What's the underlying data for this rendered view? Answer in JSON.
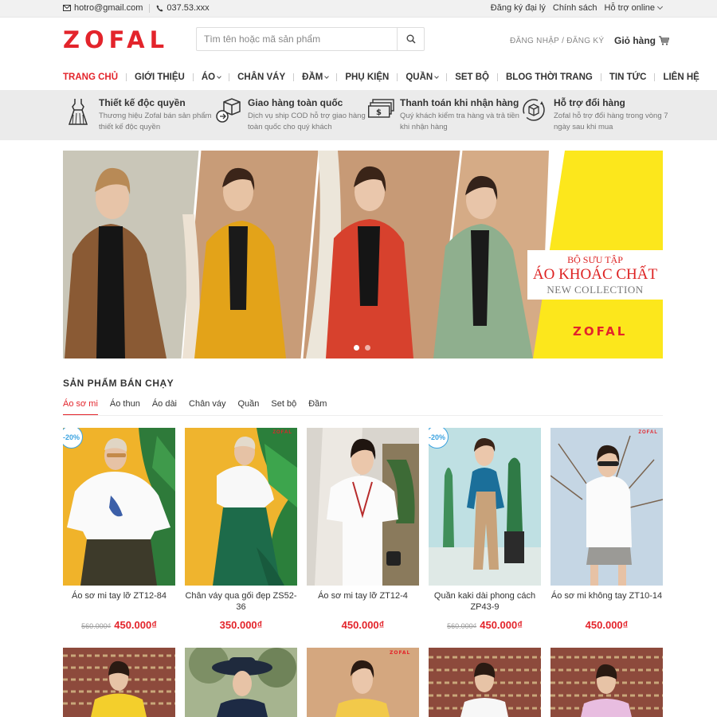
{
  "topbar": {
    "email": "hotro@gmail.com",
    "phone": "037.53.xxx",
    "agency": "Đăng ký đại lý",
    "policy": "Chính sách",
    "support": "Hỗ trợ online"
  },
  "header": {
    "logo": "ZOFAL",
    "search_placeholder": "Tìm tên hoặc mã sản phẩm",
    "login": "ĐĂNG NHẬP",
    "register": "ĐĂNG KÝ",
    "login_sep": "/",
    "cart": "Giỏ hàng"
  },
  "nav": [
    {
      "label": "TRANG CHỦ",
      "active": true
    },
    {
      "label": "GIỚI THIỆU"
    },
    {
      "label": "ÁO",
      "dropdown": true
    },
    {
      "label": "CHÂN VÁY"
    },
    {
      "label": "ĐẦM",
      "dropdown": true
    },
    {
      "label": "PHỤ KIỆN"
    },
    {
      "label": "QUẦN",
      "dropdown": true
    },
    {
      "label": "SET BỘ"
    },
    {
      "label": "BLOG THỜI TRANG"
    },
    {
      "label": "TIN TỨC"
    },
    {
      "label": "LIÊN HỆ"
    }
  ],
  "features": [
    {
      "title": "Thiết kế độc quyền",
      "desc": "Thương hiệu Zofal bán sản phẩm thiết kế độc quyền",
      "icon": "dress-icon"
    },
    {
      "title": "Giao hàng toàn quốc",
      "desc": "Dịch vụ ship COD hỗ trợ giao hàng toàn quốc cho quý khách",
      "icon": "delivery-box-icon"
    },
    {
      "title": "Thanh toán khi nhận hàng",
      "desc": "Quý khách kiểm tra hàng và trả tiền khi nhận hàng",
      "icon": "cash-icon"
    },
    {
      "title": "Hỗ trợ đổi hàng",
      "desc": "Zofal hỗ trợ đổi hàng trong vòng 7 ngày sau khi mua",
      "icon": "exchange-box-icon"
    }
  ],
  "banner": {
    "line1": "BỘ SƯU TẬP",
    "line2": "ÁO KHOÁC CHẤT",
    "line3": "NEW COLLECTION",
    "brand": "ZOFAL"
  },
  "section": {
    "title": "SẢN PHẨM BÁN CHẠY",
    "tabs": [
      {
        "label": "Áo sơ mi",
        "active": true
      },
      {
        "label": "Áo thun"
      },
      {
        "label": "Áo dài"
      },
      {
        "label": "Chân váy"
      },
      {
        "label": "Quần"
      },
      {
        "label": "Set bộ"
      },
      {
        "label": "Đầm"
      }
    ]
  },
  "products": [
    {
      "name": "Áo sơ mi tay lỡ ZT12-84",
      "old_price": "560.000₫",
      "price": "450.000₫",
      "badge": "-20%"
    },
    {
      "name": "Chân váy qua gối đẹp ZS52-36",
      "old_price": "",
      "price": "350.000₫",
      "badge": "",
      "brand": "ZOFAL"
    },
    {
      "name": "Áo sơ mi tay lỡ ZT12-4",
      "old_price": "",
      "price": "450.000₫",
      "badge": ""
    },
    {
      "name": "Quần kaki dài phong cách ZP43-9",
      "old_price": "560.000₫",
      "price": "450.000₫",
      "badge": "-20%"
    },
    {
      "name": "Áo sơ mi không tay ZT10-14",
      "old_price": "",
      "price": "450.000₫",
      "badge": "",
      "brand": "ZOFAL"
    }
  ],
  "row2_brand": "ZOFAL",
  "colors": {
    "accent": "#e3242b",
    "badge": "#3ca3e0",
    "banner_yellow": "#fce71c",
    "band": "#ebebeb"
  }
}
